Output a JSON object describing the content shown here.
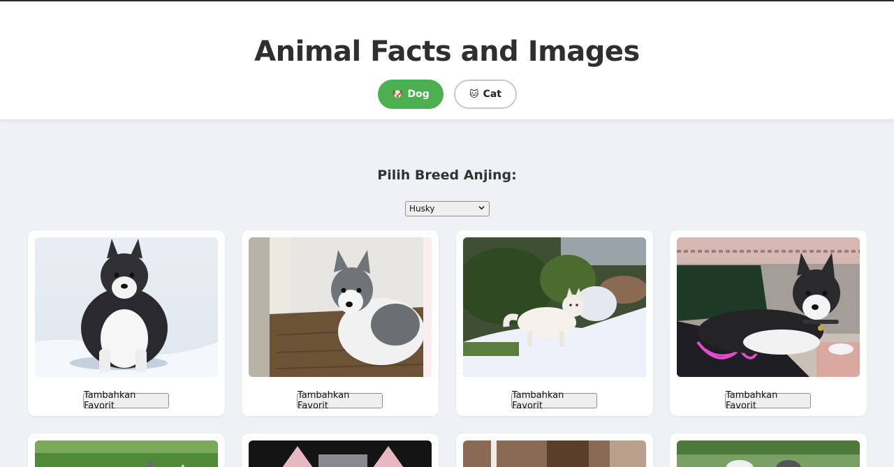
{
  "header": {
    "title": "Animal Facts and Images",
    "toggles": [
      {
        "icon": "dog-emoji-icon",
        "emoji": "🐶",
        "label": "Dog",
        "active": true
      },
      {
        "icon": "cat-emoji-icon",
        "emoji": "🐱",
        "label": "Cat",
        "active": false
      }
    ]
  },
  "breed": {
    "heading": "Pilih Breed Anjing:",
    "selected": "Husky"
  },
  "cards": [
    {
      "image": "husky-in-snow",
      "button": "Tambahkan Favorit"
    },
    {
      "image": "husky-by-door",
      "button": "Tambahkan Favorit"
    },
    {
      "image": "white-husky-garden",
      "button": "Tambahkan Favorit"
    },
    {
      "image": "husky-on-blanket",
      "button": "Tambahkan Favorit"
    }
  ],
  "colors": {
    "accent": "#4caf50",
    "background": "#f0f1f5"
  }
}
